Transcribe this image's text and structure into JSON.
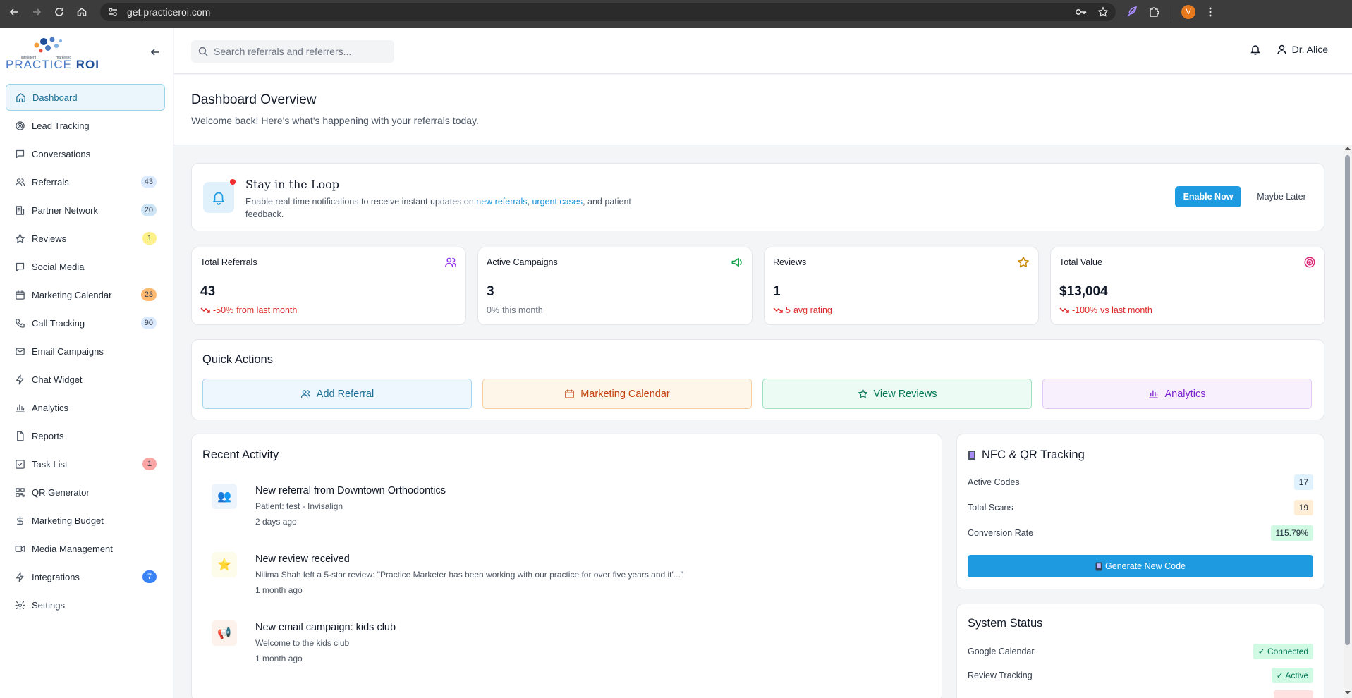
{
  "browser": {
    "url": "get.practiceroi.com",
    "profile_initial": "V"
  },
  "logo": {
    "tag_left": "intelligent",
    "tag_right": "marketing",
    "name_light": "PRACTICE ",
    "name_bold": "ROI"
  },
  "sidebar": {
    "items": [
      {
        "label": "Dashboard",
        "icon": "home-icon",
        "active": true
      },
      {
        "label": "Lead Tracking",
        "icon": "target-icon"
      },
      {
        "label": "Conversations",
        "icon": "message-icon"
      },
      {
        "label": "Referrals",
        "icon": "users-icon",
        "badge": "43",
        "badge_bg": "#dbeafe",
        "badge_fg": "#374151"
      },
      {
        "label": "Partner Network",
        "icon": "building-icon",
        "badge": "20",
        "badge_bg": "#cfe6f7",
        "badge_fg": "#374151"
      },
      {
        "label": "Reviews",
        "icon": "star-icon",
        "badge": "1",
        "badge_bg": "#fef08a",
        "badge_fg": "#374151"
      },
      {
        "label": "Social Media",
        "icon": "chat-square-icon"
      },
      {
        "label": "Marketing Calendar",
        "icon": "calendar-icon",
        "badge": "23",
        "badge_bg": "#fdba74",
        "badge_fg": "#374151"
      },
      {
        "label": "Call Tracking",
        "icon": "phone-icon",
        "badge": "90",
        "badge_bg": "#dbeafe",
        "badge_fg": "#374151"
      },
      {
        "label": "Email Campaigns",
        "icon": "mail-icon"
      },
      {
        "label": "Chat Widget",
        "icon": "bolt-icon"
      },
      {
        "label": "Analytics",
        "icon": "bar-chart-icon"
      },
      {
        "label": "Reports",
        "icon": "file-icon"
      },
      {
        "label": "Task List",
        "icon": "check-square-icon",
        "badge": "1",
        "badge_bg": "#fca5a5",
        "badge_fg": "#374151"
      },
      {
        "label": "QR Generator",
        "icon": "qr-icon"
      },
      {
        "label": "Marketing Budget",
        "icon": "dollar-icon"
      },
      {
        "label": "Media Management",
        "icon": "video-icon"
      },
      {
        "label": "Integrations",
        "icon": "bolt-icon",
        "badge": "7",
        "badge_bg": "#3b82f6",
        "badge_fg": "#ffffff"
      },
      {
        "label": "Settings",
        "icon": "gear-icon"
      }
    ]
  },
  "topbar": {
    "search_placeholder": "Search referrals and referrers...",
    "user_name": "Dr. Alice"
  },
  "header": {
    "title": "Dashboard Overview",
    "subtitle": "Welcome back! Here's what's happening with your referrals today."
  },
  "notice": {
    "title": "Stay in the Loop",
    "text_before": "Enable real-time notifications to receive instant updates on ",
    "link1": "new referrals",
    "sep": ", ",
    "link2": "urgent cases",
    "text_after": ", and patient feedback.",
    "enable_label": "Enable Now",
    "later_label": "Maybe Later"
  },
  "stats": [
    {
      "label": "Total Referrals",
      "value": "43",
      "change": "-50%",
      "change_suffix": "from last month",
      "trend": "down",
      "icon": "users-icon",
      "icon_color": "#9333ea"
    },
    {
      "label": "Active Campaigns",
      "value": "3",
      "change": "0%",
      "change_suffix": "this month",
      "trend": "flat",
      "icon": "megaphone-icon",
      "icon_color": "#16a34a"
    },
    {
      "label": "Reviews",
      "value": "1",
      "change": "5",
      "change_suffix": "avg rating",
      "trend": "down",
      "icon": "star-icon",
      "icon_color": "#ca8a04"
    },
    {
      "label": "Total Value",
      "value": "$13,004",
      "change": "-100%",
      "change_suffix": "vs last month",
      "trend": "down",
      "icon": "target-icon",
      "icon_color": "#db2777"
    }
  ],
  "quick_actions": {
    "title": "Quick Actions",
    "buttons": [
      {
        "label": "Add Referral",
        "icon": "users-icon",
        "bg": "#eef7fd",
        "border": "#a6d5f0",
        "fg": "#1d6f94"
      },
      {
        "label": "Marketing Calendar",
        "icon": "calendar-icon",
        "bg": "#fff6ea",
        "border": "#f7cf9f",
        "fg": "#c2410c"
      },
      {
        "label": "View Reviews",
        "icon": "star-icon",
        "bg": "#ecfbf3",
        "border": "#9fe3bf",
        "fg": "#047857"
      },
      {
        "label": "Analytics",
        "icon": "bar-chart-icon",
        "bg": "#f8f1fd",
        "border": "#e2c9f5",
        "fg": "#7e22ce"
      }
    ]
  },
  "recent_activity": {
    "title": "Recent Activity",
    "items": [
      {
        "title": "New referral from Downtown Orthodontics",
        "desc": "Patient: test - Invisalign",
        "time": "2 days ago",
        "icon": "people-icon",
        "glyph": "👥",
        "bg": "#eef4fb"
      },
      {
        "title": "New review received",
        "desc": "Nilima Shah left a 5-star review: \"Practice Marketer has been working with our practice for over five years and it'...\"",
        "time": "1 month ago",
        "icon": "star-icon",
        "glyph": "⭐",
        "bg": "#fdfbe9"
      },
      {
        "title": "New email campaign: kids club",
        "desc": "Welcome to the kids club",
        "time": "1 month ago",
        "icon": "megaphone-icon",
        "glyph": "📢",
        "bg": "#fdf2ec"
      }
    ]
  },
  "nfc": {
    "title": "NFC & QR Tracking",
    "rows": [
      {
        "label": "Active Codes",
        "value": "17",
        "bg": "#e0f2fe",
        "fg": "#1f2937"
      },
      {
        "label": "Total Scans",
        "value": "19",
        "bg": "#ffedd5",
        "fg": "#1f2937"
      },
      {
        "label": "Conversion Rate",
        "value": "115.79%",
        "bg": "#d1fae5",
        "fg": "#1f2937"
      }
    ],
    "button_label": "Generate New Code"
  },
  "system_status": {
    "title": "System Status",
    "rows": [
      {
        "label": "Google Calendar",
        "value": "✓ Connected"
      },
      {
        "label": "Review Tracking",
        "value": "✓ Active"
      }
    ]
  }
}
